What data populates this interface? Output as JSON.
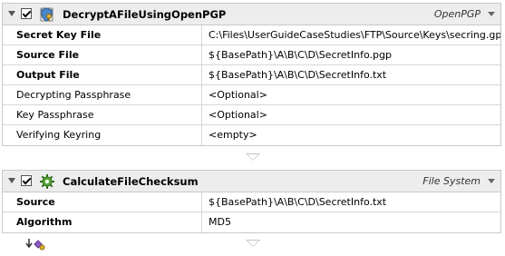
{
  "actions": [
    {
      "name": "DecryptAFileUsingOpenPGP",
      "category": "OpenPGP",
      "enabled": true,
      "icon": "pgp-key-icon",
      "fields": [
        {
          "label": "Secret Key File",
          "value": "C:\\Files\\UserGuideCaseStudies\\FTP\\Source\\Keys\\secring.gpg",
          "required": true
        },
        {
          "label": "Source File",
          "value": "${BasePath}\\A\\B\\C\\D\\SecretInfo.pgp",
          "required": true
        },
        {
          "label": "Output File",
          "value": "${BasePath}\\A\\B\\C\\D\\SecretInfo.txt",
          "required": true
        },
        {
          "label": "Decrypting Passphrase",
          "value": "<Optional>",
          "required": false
        },
        {
          "label": "Key Passphrase",
          "value": "<Optional>",
          "required": false
        },
        {
          "label": "Verifying Keyring",
          "value": "<empty>",
          "required": false
        }
      ]
    },
    {
      "name": "CalculateFileChecksum",
      "category": "File System",
      "enabled": true,
      "icon": "checksum-icon",
      "fields": [
        {
          "label": "Source",
          "value": "${BasePath}\\A\\B\\C\\D\\SecretInfo.txt",
          "required": true
        },
        {
          "label": "Algorithm",
          "value": "MD5",
          "required": true
        }
      ]
    }
  ],
  "footer": {
    "add_icon": "add-action-icon"
  }
}
